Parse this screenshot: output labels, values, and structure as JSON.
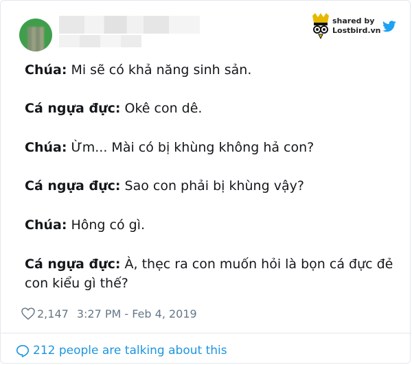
{
  "tweet": {
    "lines": [
      {
        "speaker": "Chúa:",
        "text": " Mi sẽ có khả năng sinh sản."
      },
      {
        "speaker": "Cá ngựa đực:",
        "text": " Okê con dê."
      },
      {
        "speaker": "Chúa:",
        "text": " Ừm... Mài có bị khùng không hả con?"
      },
      {
        "speaker": "Cá ngựa đực:",
        "text": " Sao con phải bị khùng vậy?"
      },
      {
        "speaker": "Chúa:",
        "text": " Hông có gì."
      },
      {
        "speaker": "Cá ngựa đực:",
        "text": " À, thẹc ra con muốn hỏi là bọn cá đực đẻ",
        "continuation": "con kiểu gì thế?"
      }
    ],
    "likes": "2,147",
    "timestamp": "3:27 PM - Feb 4, 2019",
    "talking": "212 people are talking about this"
  },
  "watermark": {
    "line1": "shared by",
    "line2": "Lostbird.vn",
    "icon": "lostbird-logo-icon",
    "bird_icon": "twitter-bird-icon"
  },
  "colors": {
    "text": "#14171a",
    "meta": "#657786",
    "link": "#1b95e0",
    "twitter": "#1da1f2",
    "logo": "#e6b800"
  }
}
